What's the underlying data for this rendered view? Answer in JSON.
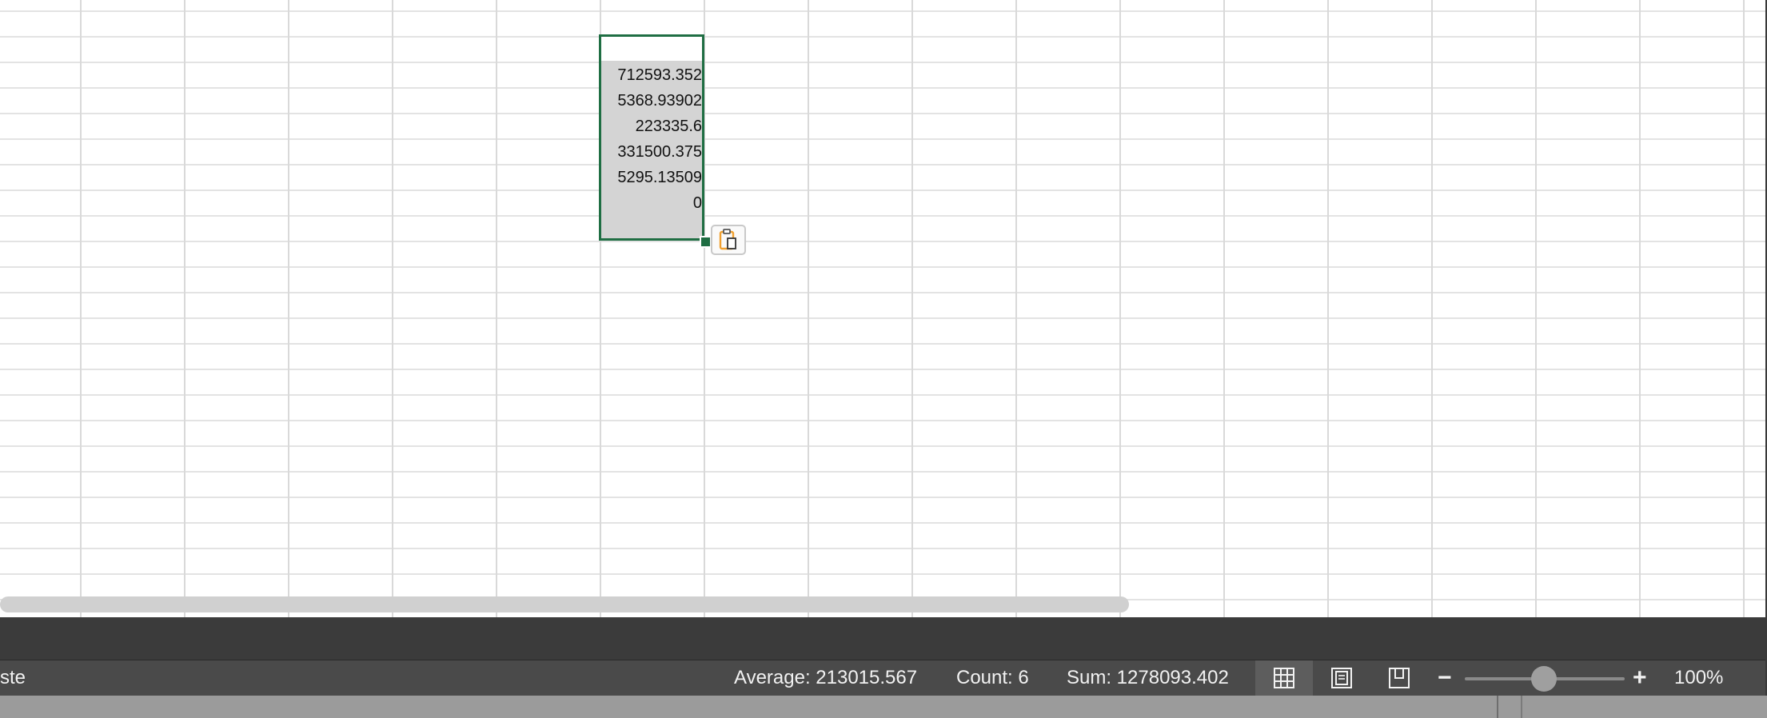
{
  "cells": [
    {
      "value": "712593.352"
    },
    {
      "value": "5368.93902"
    },
    {
      "value": "223335.6"
    },
    {
      "value": "331500.375"
    },
    {
      "value": "5295.13509"
    },
    {
      "value": "0"
    }
  ],
  "status_bar": {
    "left_fragment": "ste",
    "average": "Average: 213015.567",
    "count": "Count: 6",
    "sum": "Sum: 1278093.402",
    "zoom_minus": "−",
    "zoom_plus": "+",
    "zoom_percent": "100%"
  },
  "icons": {
    "paste_options": "clipboard-paste-icon",
    "normal_view": "grid-view-icon",
    "page_layout": "page-layout-icon",
    "page_break": "page-break-preview-icon"
  },
  "colors": {
    "selection_border": "#1f6e43",
    "status_bar_bg": "#4a4a4a",
    "paste_icon_accent": "#f0a030"
  },
  "zoom_level": 0.5
}
